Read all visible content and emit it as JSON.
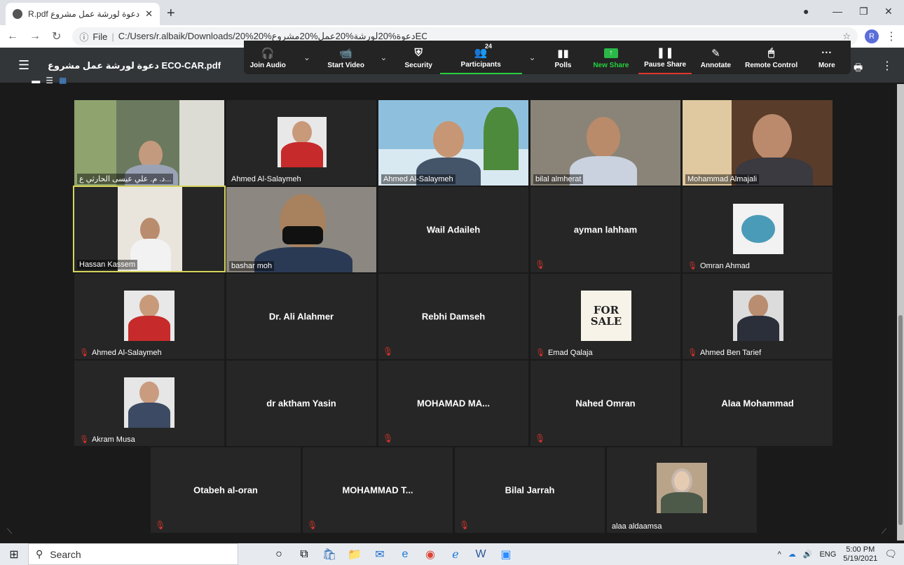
{
  "browser": {
    "tab_title": "دعوة لورشة عمل مشروع ECO-CAR.pdf",
    "new_tab": "+",
    "url_prefix": "File",
    "url": "C:/Users/r.albaik/Downloads/20%دعوة%20لورشة%20عمل%20مشروع%20ECO-CAR.pdf",
    "profile_initial": "R"
  },
  "pdf_viewer": {
    "title": "دعوة لورشة عمل مشروع ECO-CAR.pdf"
  },
  "zoom_toolbar": {
    "join_audio": "Join Audio",
    "start_video": "Start Video",
    "security": "Security",
    "participants": "Participants",
    "participants_count": "24",
    "polls": "Polls",
    "new_share": "New Share",
    "pause_share": "Pause Share",
    "annotate": "Annotate",
    "remote_control": "Remote Control",
    "more": "More"
  },
  "tiles": [
    {
      "name": "د. م. علي عيسى الحارثي ع...",
      "type": "video",
      "muted": false
    },
    {
      "name": "Ahmed Al-Salaymeh",
      "type": "photo",
      "muted": false
    },
    {
      "name": "Ahmed Al-Salaymeh",
      "type": "video",
      "muted": false
    },
    {
      "name": "bilal almherat",
      "type": "video",
      "muted": false
    },
    {
      "name": "Mohammad Almajali",
      "type": "video",
      "muted": false
    },
    {
      "name": "Hassan Kassem",
      "type": "video",
      "muted": false,
      "active": true
    },
    {
      "name": "bashar moh",
      "type": "video",
      "muted": false
    },
    {
      "name": "Wail Adaileh",
      "type": "text",
      "muted": false
    },
    {
      "name": "ayman lahham",
      "type": "text",
      "muted": true
    },
    {
      "name": "Omran Ahmad",
      "type": "photo",
      "muted": true
    },
    {
      "name": "Ahmed Al-Salaymeh",
      "type": "photo",
      "muted": true
    },
    {
      "name": "Dr. Ali Alahmer",
      "type": "text",
      "muted": false
    },
    {
      "name": "Rebhi Damseh",
      "type": "text",
      "muted": true
    },
    {
      "name": "Emad Qalaja",
      "type": "photo",
      "muted": true
    },
    {
      "name": "Ahmed Ben Tarief",
      "type": "photo",
      "muted": true
    },
    {
      "name": "Akram Musa",
      "type": "photo",
      "muted": true
    },
    {
      "name": "dr aktham Yasin",
      "type": "text",
      "muted": false
    },
    {
      "name": "MOHAMAD MA...",
      "type": "text",
      "muted": true
    },
    {
      "name": "Nahed Omran",
      "type": "text",
      "muted": true
    },
    {
      "name": "Alaa Mohammad",
      "type": "text",
      "muted": false
    },
    {
      "name": "Otabeh al-oran",
      "type": "text",
      "muted": true
    },
    {
      "name": "MOHAMMAD T...",
      "type": "text",
      "muted": true
    },
    {
      "name": "Bilal Jarrah",
      "type": "text",
      "muted": true
    },
    {
      "name": "alaa aldaamsa",
      "type": "photo",
      "muted": false
    }
  ],
  "for_sale_sign": "FOR SALE",
  "taskbar": {
    "search_placeholder": "Search",
    "language": "ENG",
    "time": "5:00 PM",
    "date": "5/19/2021"
  }
}
